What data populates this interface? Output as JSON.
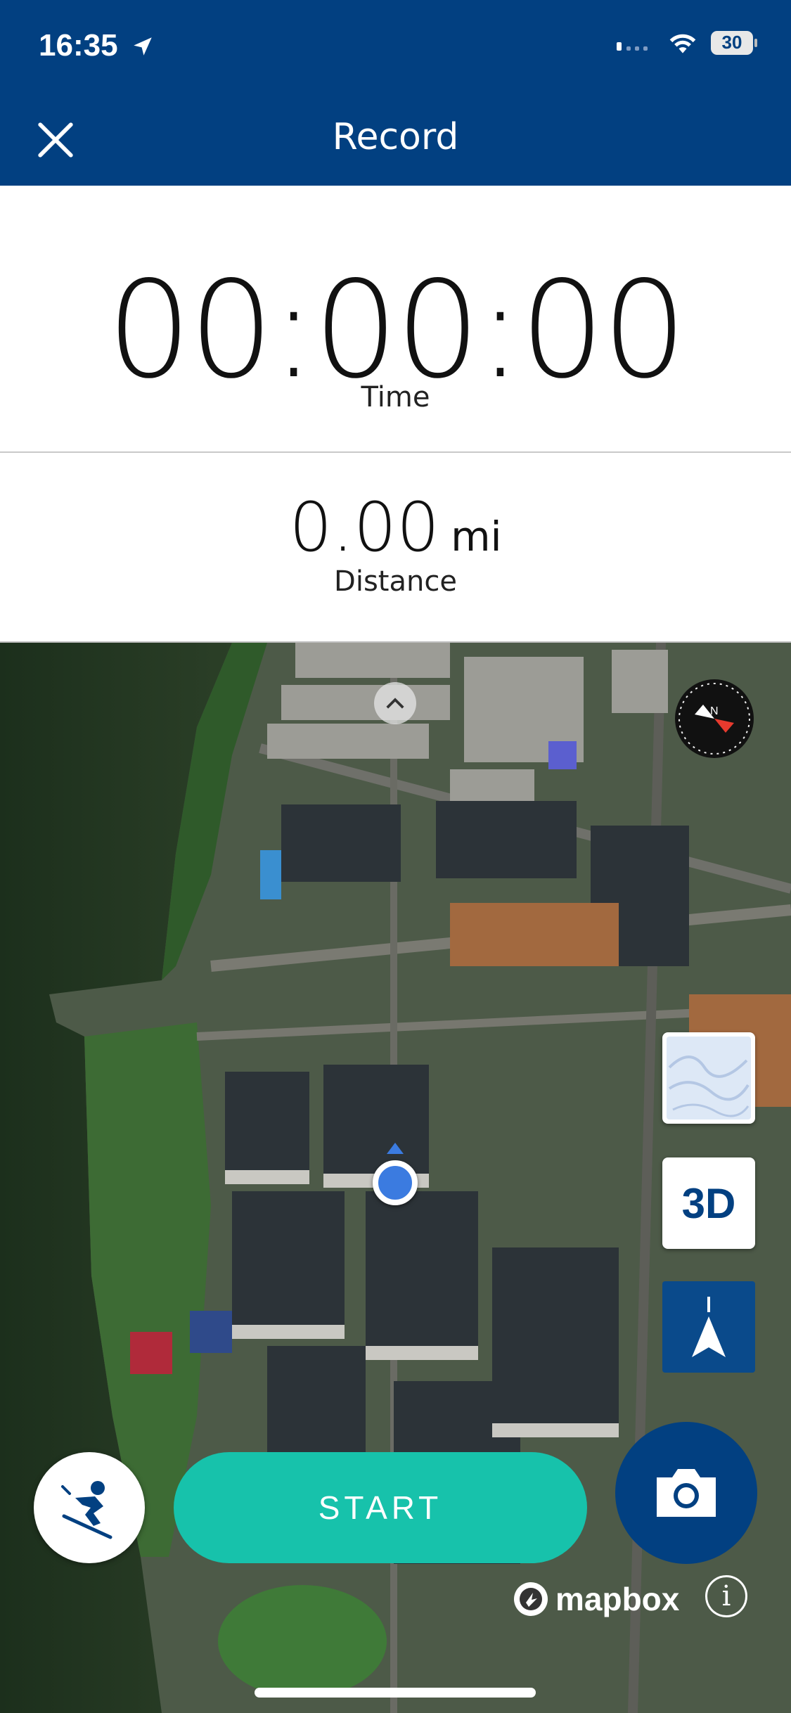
{
  "status_bar": {
    "time": "16:35",
    "battery": "30"
  },
  "header": {
    "title": "Record"
  },
  "timer": {
    "value": "00:00:00",
    "label": "Time"
  },
  "distance": {
    "value": "0.00",
    "unit": "mi",
    "label": "Distance"
  },
  "map": {
    "layer_3d_label": "3D",
    "start_label": "START",
    "attribution": "mapbox",
    "info_label": "i"
  },
  "colors": {
    "header": "#024081",
    "start": "#17c2ab",
    "location": "#3b7be0"
  },
  "icons": [
    "location-arrow-icon",
    "signal-icon",
    "wifi-icon",
    "battery-icon",
    "close-icon",
    "chevron-up-icon",
    "compass-icon",
    "terrain-icon",
    "navigation-arrow-icon",
    "skier-icon",
    "camera-icon",
    "mapbox-logo-icon",
    "info-icon"
  ]
}
